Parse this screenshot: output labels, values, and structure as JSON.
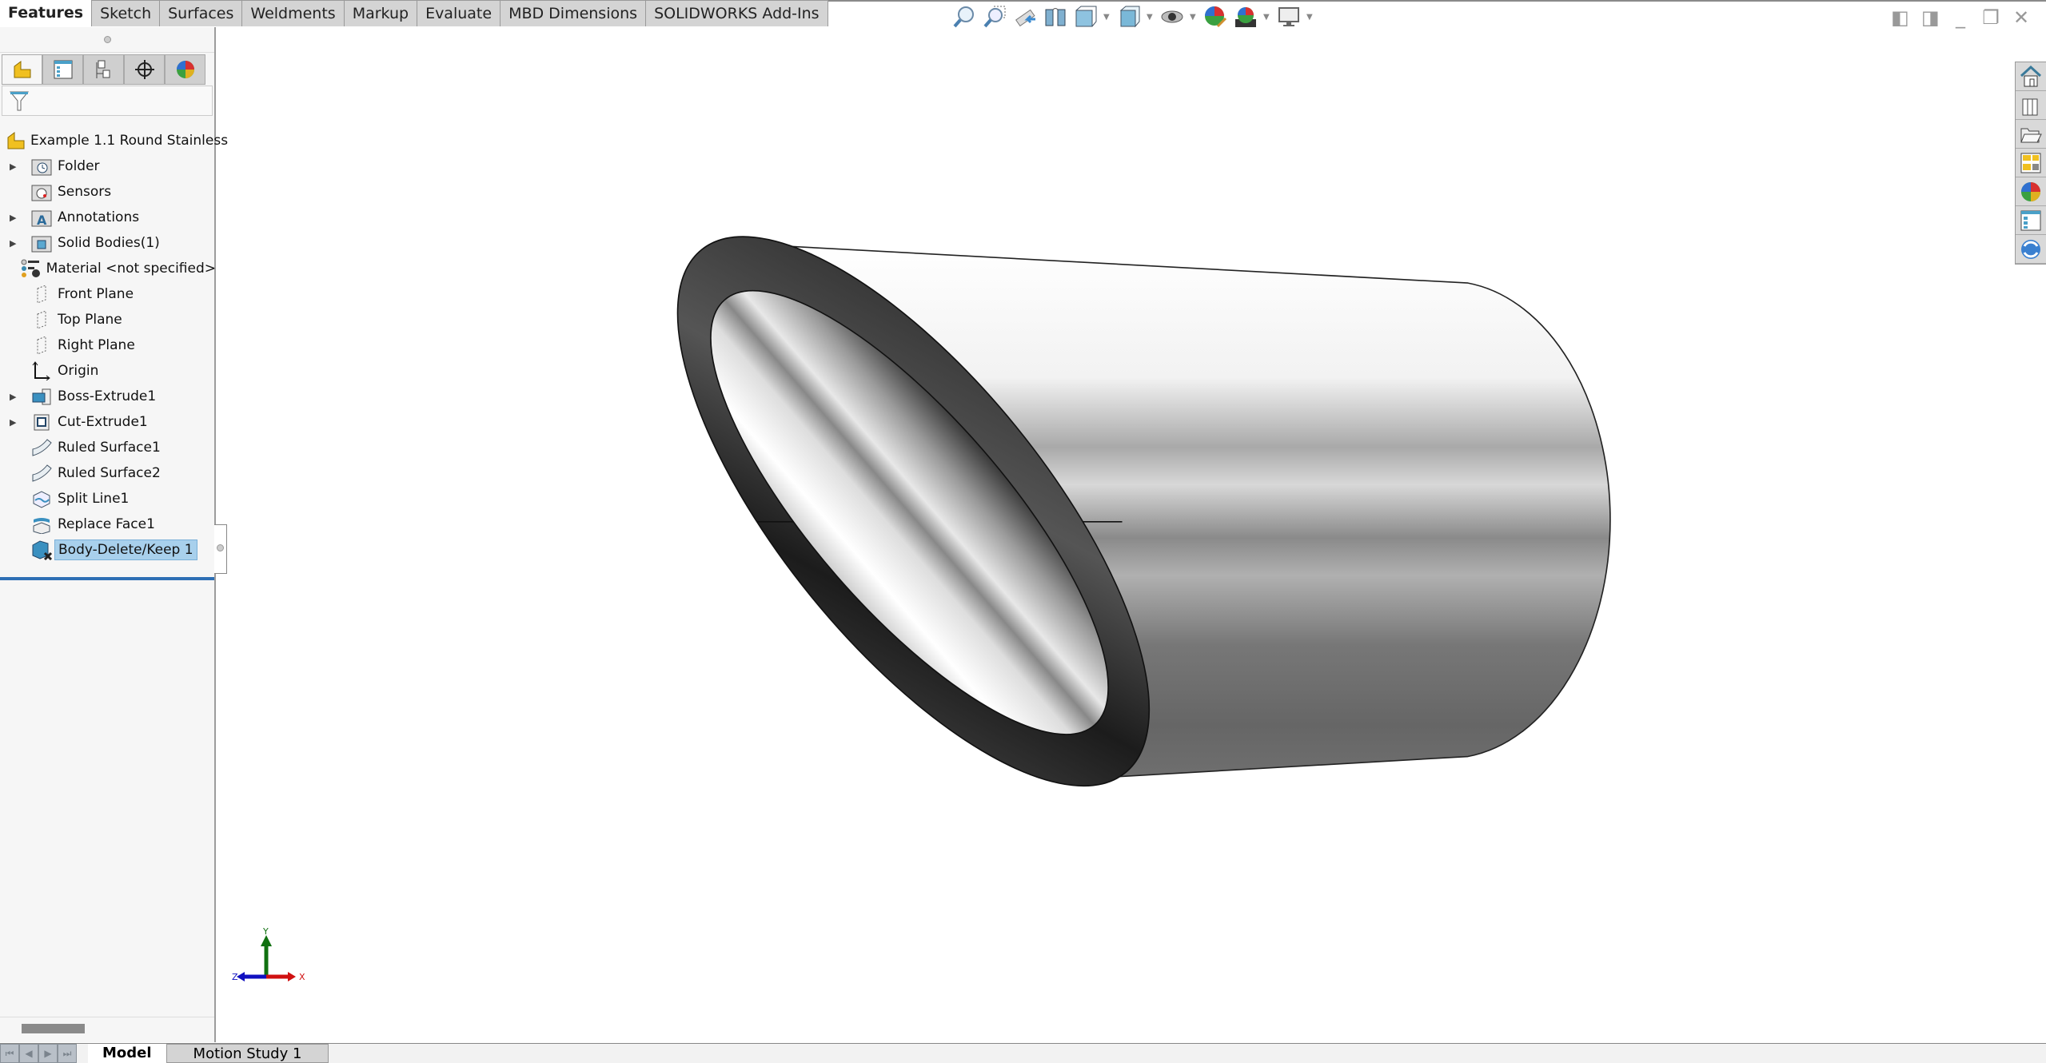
{
  "command_tabs": [
    {
      "label": "Features",
      "active": true
    },
    {
      "label": "Sketch"
    },
    {
      "label": "Surfaces"
    },
    {
      "label": "Weldments"
    },
    {
      "label": "Markup"
    },
    {
      "label": "Evaluate"
    },
    {
      "label": "MBD Dimensions"
    },
    {
      "label": "SOLIDWORKS Add-Ins"
    }
  ],
  "panel_tabs": [
    "featuremanager-icon",
    "propertymanager-icon",
    "configurationmanager-icon",
    "dimxpert-icon",
    "display-manager-icon"
  ],
  "tree": {
    "root": "Example 1.1 Round Stainless",
    "items": [
      {
        "label": "Folder",
        "expandable": true,
        "icon": "history-folder-icon"
      },
      {
        "label": "Sensors",
        "expandable": false,
        "icon": "sensors-icon"
      },
      {
        "label": "Annotations",
        "expandable": true,
        "icon": "annotations-icon"
      },
      {
        "label": "Solid Bodies(1)",
        "expandable": true,
        "icon": "solid-bodies-icon"
      },
      {
        "label": "Material <not specified>",
        "expandable": false,
        "icon": "material-icon"
      },
      {
        "label": "Front Plane",
        "expandable": false,
        "icon": "plane-icon"
      },
      {
        "label": "Top Plane",
        "expandable": false,
        "icon": "plane-icon"
      },
      {
        "label": "Right Plane",
        "expandable": false,
        "icon": "plane-icon"
      },
      {
        "label": "Origin",
        "expandable": false,
        "icon": "origin-icon"
      },
      {
        "label": "Boss-Extrude1",
        "expandable": true,
        "icon": "boss-extrude-icon"
      },
      {
        "label": "Cut-Extrude1",
        "expandable": true,
        "icon": "cut-extrude-icon"
      },
      {
        "label": "Ruled Surface1",
        "expandable": false,
        "icon": "ruled-surface-icon"
      },
      {
        "label": "Ruled Surface2",
        "expandable": false,
        "icon": "ruled-surface-icon"
      },
      {
        "label": "Split Line1",
        "expandable": false,
        "icon": "split-line-icon"
      },
      {
        "label": "Replace Face1",
        "expandable": false,
        "icon": "replace-face-icon"
      },
      {
        "label": "Body-Delete/Keep 1",
        "expandable": false,
        "icon": "body-delete-icon",
        "selected": true
      }
    ]
  },
  "bottom_tabs": [
    {
      "label": "Model",
      "active": true
    },
    {
      "label": "Motion Study 1"
    }
  ],
  "view_toolbar": [
    "zoom-to-fit-icon",
    "zoom-to-area-icon",
    "previous-view-icon",
    "section-view-icon",
    "view-orientation-icon",
    "display-style-icon",
    "hide-show-items-icon",
    "edit-appearance-icon",
    "apply-scene-icon",
    "view-settings-icon"
  ],
  "task_pane": [
    "home-icon",
    "design-library-icon",
    "file-explorer-icon",
    "view-palette-icon",
    "appearances-icon",
    "custom-properties-icon",
    "solidworks-resources-icon"
  ],
  "triad": {
    "x": "X",
    "y": "Y",
    "z": "Z"
  },
  "colors": {
    "selection": "#a8d0ec",
    "active_underline": "#2e6fb5",
    "triad_x": "#d01010",
    "triad_y": "#107010",
    "triad_z": "#1010c0"
  }
}
